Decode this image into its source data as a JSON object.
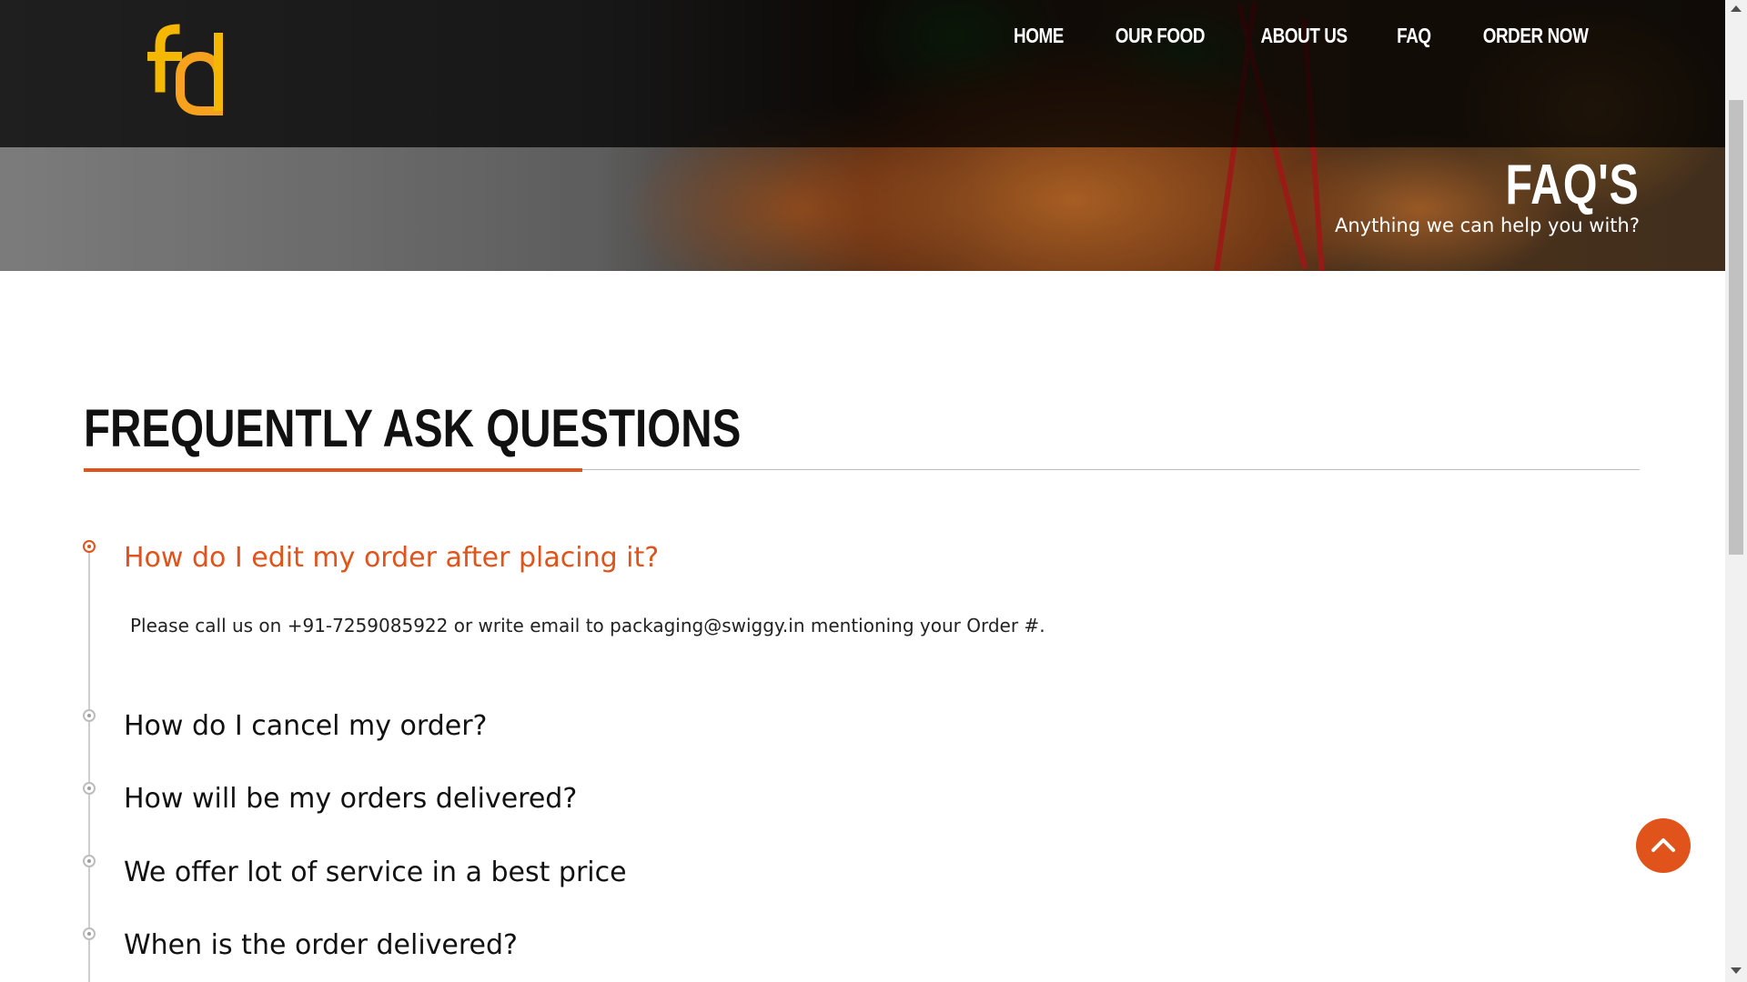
{
  "brand": {
    "logo_text": "fd",
    "colors": {
      "logo_primary": "#f5b800",
      "logo_secondary": "#f7a21c"
    }
  },
  "nav": {
    "items": [
      "HOME",
      "OUR FOOD",
      "ABOUT US",
      "FAQ",
      "ORDER NOW"
    ]
  },
  "hero": {
    "title": "FAQ'S",
    "subtitle": "Anything we can help you with?"
  },
  "section": {
    "title": "FREQUENTLY ASK QUESTIONS"
  },
  "faq": {
    "items": [
      {
        "question": "How do I edit my order after placing it?",
        "answer": "Please call us on +91-7259085922 or write email to packaging@swiggy.in mentioning your Order #.",
        "expanded": true
      },
      {
        "question": "How do I cancel my order?",
        "expanded": false
      },
      {
        "question": "How will be my orders delivered?",
        "expanded": false
      },
      {
        "question": "We offer lot of service in a best price",
        "expanded": false
      },
      {
        "question": "When is the order delivered?",
        "expanded": false
      }
    ]
  },
  "back_to_top": {
    "icon": "chevron-up-icon"
  },
  "colors": {
    "accent": "#e0531a",
    "text": "#111111"
  }
}
